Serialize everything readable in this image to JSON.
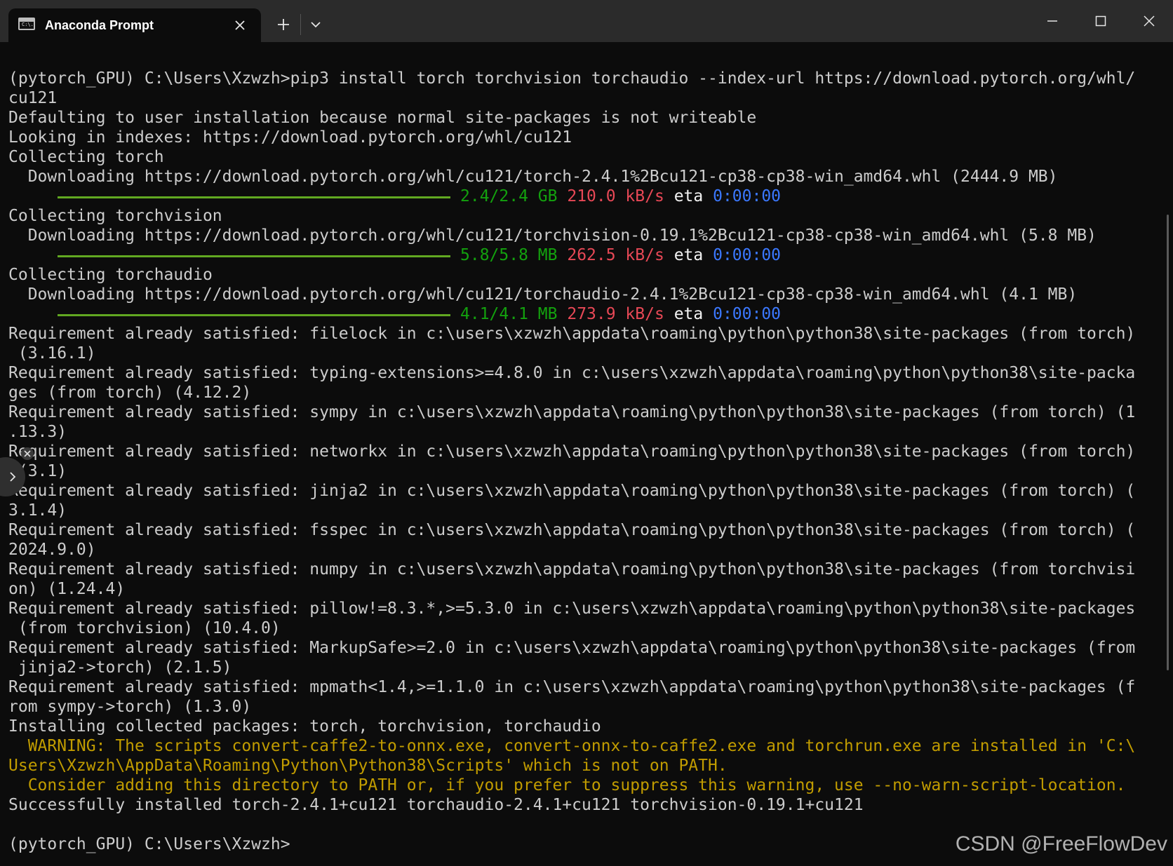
{
  "window": {
    "tab_title": "Anaconda Prompt",
    "tab_icon": "C:\\.",
    "icons": {
      "tab": "terminal-icon",
      "close_tab": "close-icon",
      "new_tab": "plus-icon",
      "dropdown": "chevron-down-icon",
      "minimize": "minimize-icon",
      "maximize": "maximize-icon",
      "close": "close-icon"
    }
  },
  "colors": {
    "background": "#0c0c0c",
    "titlebar": "#2b2b2b",
    "text": "#cccccc",
    "green": "#13a10e",
    "red": "#e74856",
    "blue": "#3b78ff",
    "yellow": "#c19c00",
    "progress": "#61a821"
  },
  "terminal": {
    "command_1": "(pytorch_GPU) C:\\Users\\Xzwzh>pip3 install torch torchvision torchaudio --index-url https://download.pytorch.org/whl/",
    "command_1_wrap": "cu121",
    "defaulting": "Defaulting to user installation because normal site-packages is not writeable",
    "looking": "Looking in indexes: https://download.pytorch.org/whl/cu121",
    "downloads": [
      {
        "collecting": "Collecting torch",
        "downloading": "  Downloading https://download.pytorch.org/whl/cu121/torch-2.4.1%2Bcu121-cp38-cp38-win_amd64.whl (2444.9 MB)",
        "progress": 1.0,
        "size": "2.4/2.4 GB",
        "speed": "210.0 kB/s",
        "eta_label": "eta",
        "eta": "0:00:00"
      },
      {
        "collecting": "Collecting torchvision",
        "downloading": "  Downloading https://download.pytorch.org/whl/cu121/torchvision-0.19.1%2Bcu121-cp38-cp38-win_amd64.whl (5.8 MB)",
        "progress": 1.0,
        "size": "5.8/5.8 MB",
        "speed": "262.5 kB/s",
        "eta_label": "eta",
        "eta": "0:00:00"
      },
      {
        "collecting": "Collecting torchaudio",
        "downloading": "  Downloading https://download.pytorch.org/whl/cu121/torchaudio-2.4.1%2Bcu121-cp38-cp38-win_amd64.whl (4.1 MB)",
        "progress": 1.0,
        "size": "4.1/4.1 MB",
        "speed": "273.9 kB/s",
        "eta_label": "eta",
        "eta": "0:00:00"
      }
    ],
    "requirements": [
      "Requirement already satisfied: filelock in c:\\users\\xzwzh\\appdata\\roaming\\python\\python38\\site-packages (from torch)",
      " (3.16.1)",
      "Requirement already satisfied: typing-extensions>=4.8.0 in c:\\users\\xzwzh\\appdata\\roaming\\python\\python38\\site-packa",
      "ges (from torch) (4.12.2)",
      "Requirement already satisfied: sympy in c:\\users\\xzwzh\\appdata\\roaming\\python\\python38\\site-packages (from torch) (1",
      ".13.3)",
      "Requirement already satisfied: networkx in c:\\users\\xzwzh\\appdata\\roaming\\python\\python38\\site-packages (from torch)",
      " (3.1)",
      "Requirement already satisfied: jinja2 in c:\\users\\xzwzh\\appdata\\roaming\\python\\python38\\site-packages (from torch) (",
      "3.1.4)",
      "Requirement already satisfied: fsspec in c:\\users\\xzwzh\\appdata\\roaming\\python\\python38\\site-packages (from torch) (",
      "2024.9.0)",
      "Requirement already satisfied: numpy in c:\\users\\xzwzh\\appdata\\roaming\\python\\python38\\site-packages (from torchvisi",
      "on) (1.24.4)",
      "Requirement already satisfied: pillow!=8.3.*,>=5.3.0 in c:\\users\\xzwzh\\appdata\\roaming\\python\\python38\\site-packages",
      " (from torchvision) (10.4.0)",
      "Requirement already satisfied: MarkupSafe>=2.0 in c:\\users\\xzwzh\\appdata\\roaming\\python\\python38\\site-packages (from",
      " jinja2->torch) (2.1.5)",
      "Requirement already satisfied: mpmath<1.4,>=1.1.0 in c:\\users\\xzwzh\\appdata\\roaming\\python\\python38\\site-packages (f",
      "rom sympy->torch) (1.3.0)"
    ],
    "installing": "Installing collected packages: torch, torchvision, torchaudio",
    "warnings": [
      "  WARNING: The scripts convert-caffe2-to-onnx.exe, convert-onnx-to-caffe2.exe and torchrun.exe are installed in 'C:\\",
      "Users\\Xzwzh\\AppData\\Roaming\\Python\\Python38\\Scripts' which is not on PATH.",
      "  Consider adding this directory to PATH or, if you prefer to suppress this warning, use --no-warn-script-location."
    ],
    "success": "Successfully installed torch-2.4.1+cu121 torchaudio-2.4.1+cu121 torchvision-0.19.1+cu121",
    "prompt": "(pytorch_GPU) C:\\Users\\Xzwzh>"
  },
  "watermark": "CSDN @FreeFlowDev"
}
